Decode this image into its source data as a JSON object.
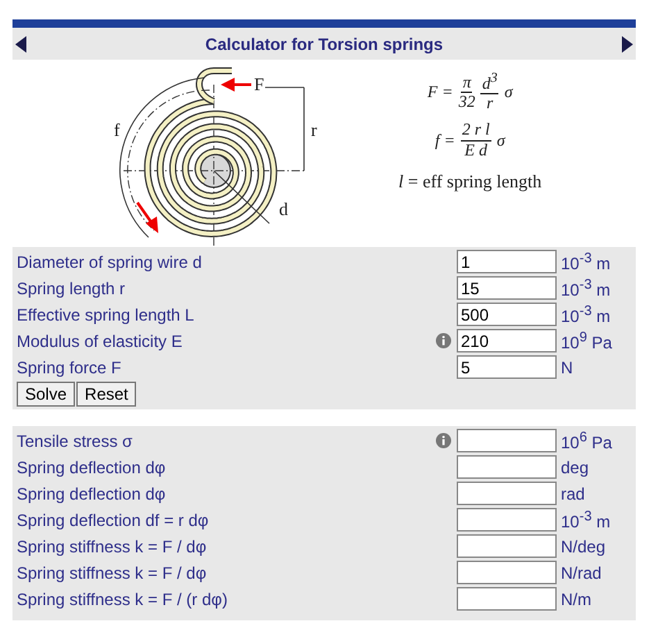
{
  "title": "Calculator for Torsion springs",
  "diagram_labels": {
    "force": "F",
    "radius": "r",
    "deflection": "f",
    "diameter": "d"
  },
  "formulas": [
    {
      "lhs": "F =",
      "fractions": [
        {
          "num": "π",
          "den": "32"
        },
        {
          "num": "d$^{3}$",
          "den": "r"
        }
      ],
      "tail": "σ"
    },
    {
      "lhs": "f =",
      "fractions": [
        {
          "num": "2 r l",
          "den": "E d"
        }
      ],
      "tail": "σ"
    }
  ],
  "legend": "*l* =  eff  spring  length",
  "inputs": [
    {
      "label": "Diameter of spring wire d",
      "info": false,
      "value": "1",
      "unit": "10$^{-3}$ m"
    },
    {
      "label": "Spring length r",
      "info": false,
      "value": "15",
      "unit": "10$^{-3}$ m"
    },
    {
      "label": "Effective spring length L",
      "info": false,
      "value": "500",
      "unit": "10$^{-3}$ m"
    },
    {
      "label": "Modulus of elasticity E",
      "info": true,
      "value": "210",
      "unit": "10$^{9}$ Pa"
    },
    {
      "label": "Spring force F",
      "info": false,
      "value": "5",
      "unit": "N"
    }
  ],
  "buttons": [
    "Solve",
    "Reset"
  ],
  "results": [
    {
      "label": "Tensile stress σ",
      "info": true,
      "unit": "10$^{6}$ Pa"
    },
    {
      "label": "Spring deflection dφ",
      "info": false,
      "unit": "deg"
    },
    {
      "label": "Spring deflection dφ",
      "info": false,
      "unit": "rad"
    },
    {
      "label": "Spring deflection df = r dφ",
      "info": false,
      "unit": "10$^{-3}$ m"
    },
    {
      "label": "Spring stiffness k = F / dφ",
      "info": false,
      "unit": "N/deg"
    },
    {
      "label": "Spring stiffness k = F / dφ",
      "info": false,
      "unit": "N/rad"
    },
    {
      "label": "Spring stiffness k = F / (r dφ)",
      "info": false,
      "unit": "N/m"
    }
  ]
}
